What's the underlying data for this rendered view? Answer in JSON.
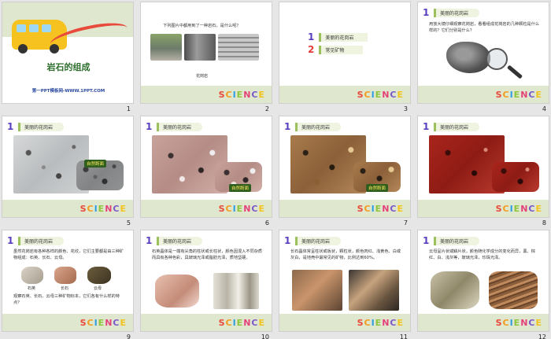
{
  "slides": [
    {
      "num": "1",
      "title": "岩石的组成",
      "footer": "第一PPT模板网-WWW.1PPT.COM"
    },
    {
      "num": "2",
      "question": "下列图片中都用到了一种岩石，是什么呢？",
      "caption": "花岗岩"
    },
    {
      "num": "3",
      "menu": [
        "美丽的花岗岩",
        "常见矿物"
      ]
    },
    {
      "num": "4",
      "tag": "美丽的花岗岩",
      "text": "用放大镜仔细观察花岗岩，看看组成花岗岩的几种颗粒是什么样的？它们分别是什么？"
    },
    {
      "num": "5",
      "tag": "美丽的花岗岩",
      "badge": "自然断面"
    },
    {
      "num": "6",
      "tag": "美丽的花岗岩",
      "badge": "自然断面"
    },
    {
      "num": "7",
      "tag": "美丽的花岗岩",
      "badge": "自然断面"
    },
    {
      "num": "8",
      "tag": "美丽的花岗岩"
    },
    {
      "num": "9",
      "tag": "美丽的花岗岩",
      "text": "虽然花岗岩有各种各样的颜色、花纹，它们主要都是由三种矿物组成：石英、长石、云母。",
      "labels": [
        "石英",
        "长石",
        "云母"
      ],
      "text2": "观察石英、长石、云母三种矿物标本，它们各有什么样的特点？"
    },
    {
      "num": "10",
      "tag": "美丽的花岗岩",
      "text": "石英晶体是一端有尖角的柱状或长柱状，颜色因混入不同杂质而具有各种色彩，具玻璃光泽或脂肪光泽，质地坚硬。"
    },
    {
      "num": "11",
      "tag": "美丽的花岗岩",
      "text": "长石晶体常呈柱状或板状，颗粒状，颜色肉红、浅黄色、白或灰白，是地壳中最常见的矿物，比例达到60%。"
    },
    {
      "num": "12",
      "tag": "美丽的花岗岩",
      "text": "云母呈片状或鳞片状，颜色随化学成分的变化而异，黑、棕红、白、浅灰等，玻璃光泽，珍珠光泽。"
    }
  ],
  "brand": [
    "S",
    "C",
    "I",
    "E",
    "N",
    "C",
    "E"
  ],
  "colors": {
    "band": "#dfe8cf",
    "accent": "#9cc05c",
    "icon": "#5a3fc0"
  }
}
